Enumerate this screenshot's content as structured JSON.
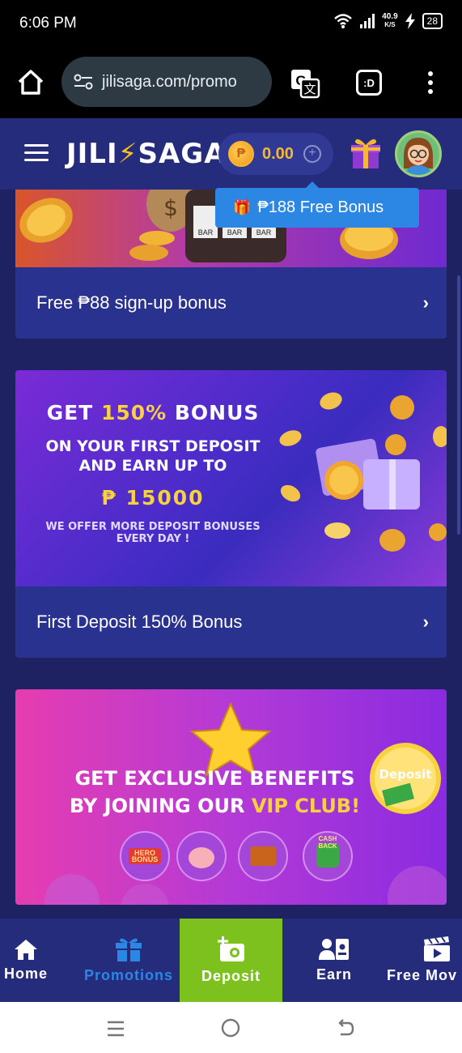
{
  "status_bar": {
    "time": "6:06 PM",
    "net_speed_value": "40.9",
    "net_speed_unit": "K/S",
    "battery": "28"
  },
  "browser": {
    "url": "jilisaga.com/promo",
    "tab_label": ":D"
  },
  "header": {
    "logo_left": "JILI",
    "logo_right": "SAGA",
    "balance": "0.00",
    "coin_symbol": "₱",
    "bonus_tip": "₱188 Free Bonus"
  },
  "promotions": [
    {
      "title": "Free ₱88 sign-up bonus"
    },
    {
      "title": "First Deposit 150% Bonus",
      "banner": {
        "line1_a": "GET ",
        "line1_b": "150%",
        "line1_c": " BONUS",
        "line2": "ON YOUR FIRST DEPOSIT",
        "line3": "AND EARN UP TO",
        "amount": "₱ 15000",
        "line4": "WE OFFER MORE DEPOSIT BONUSES",
        "line5": "EVERY DAY !"
      }
    },
    {
      "banner": {
        "line1": "GET EXCLUSIVE BENEFITS",
        "line2_a": "BY JOINING OUR ",
        "line2_b": "VIP CLUB!",
        "deposit_badge": "Deposit",
        "hero_bonus": "HERO",
        "hero_bonus_sub": "BONUS",
        "cash_back": "CASH BACK"
      }
    }
  ],
  "bottom_nav": [
    {
      "label": "Home"
    },
    {
      "label": "Promotions"
    },
    {
      "label": "Deposit"
    },
    {
      "label": "Earn"
    },
    {
      "label": "Free Mov"
    }
  ],
  "colors": {
    "page_bg": "#1e2262",
    "header_bg": "#252c7c",
    "card_bg": "#2a3290",
    "accent_blue": "#2c86e3",
    "deposit_green": "#7cc11e",
    "gold": "#f7b731"
  }
}
